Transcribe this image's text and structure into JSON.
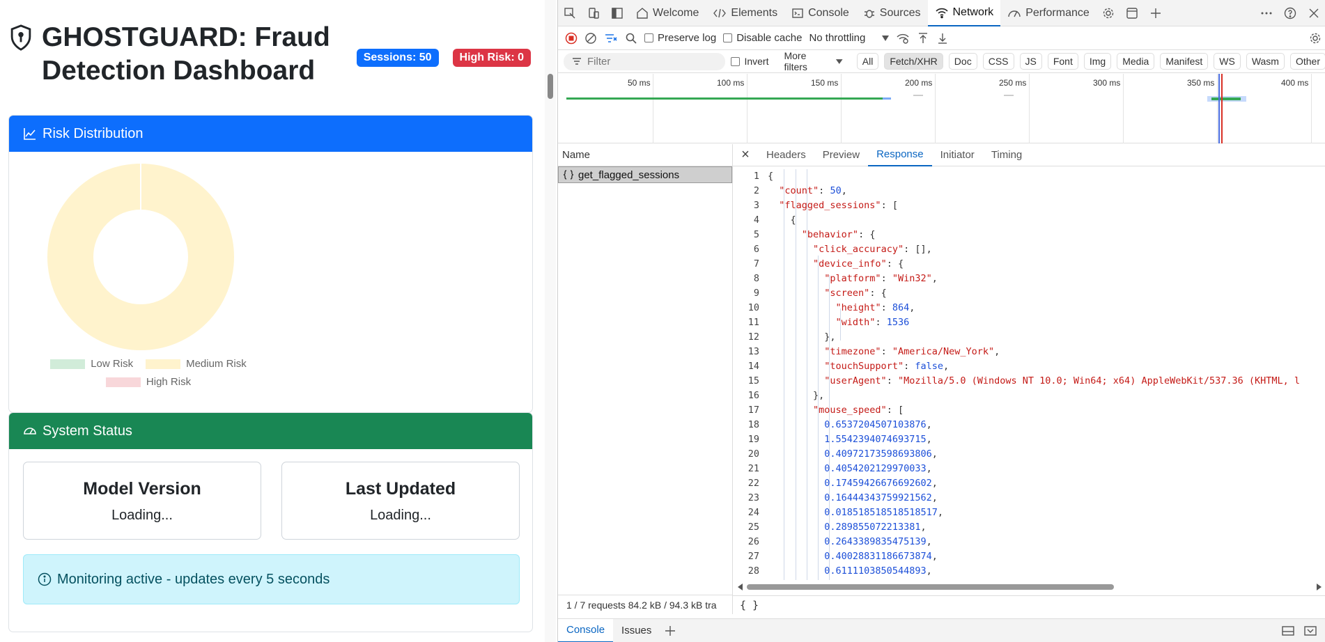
{
  "page": {
    "title": "GHOSTGUARD: Fraud Detection Dashboard",
    "badges": {
      "sessions": "Sessions: 50",
      "high_risk": "High Risk: 0"
    },
    "risk_card": {
      "title": "Risk Distribution",
      "legend": [
        "Low Risk",
        "Medium Risk",
        "High Risk"
      ],
      "colors": {
        "low": "#d1ecd9",
        "medium": "#fff3cd",
        "high": "#f8d7da"
      }
    },
    "status_card": {
      "title": "System Status",
      "model_label": "Model Version",
      "model_value": "Loading...",
      "updated_label": "Last Updated",
      "updated_value": "Loading...",
      "monitoring": "Monitoring active - updates every 5 seconds"
    }
  },
  "devtools": {
    "tabs": [
      "Welcome",
      "Elements",
      "Console",
      "Sources",
      "Network",
      "Performance"
    ],
    "active_tab": "Network",
    "toolbar": {
      "preserve_log": "Preserve log",
      "disable_cache": "Disable cache",
      "throttling": "No throttling"
    },
    "filterbar": {
      "filter_placeholder": "Filter",
      "invert": "Invert",
      "more_filters": "More filters",
      "types": [
        "All",
        "Fetch/XHR",
        "Doc",
        "CSS",
        "JS",
        "Font",
        "Img",
        "Media",
        "Manifest",
        "WS",
        "Wasm",
        "Other"
      ]
    },
    "timeline_ticks": [
      "50 ms",
      "100 ms",
      "150 ms",
      "200 ms",
      "250 ms",
      "300 ms",
      "350 ms",
      "400 ms"
    ],
    "name_header": "Name",
    "request_name": "get_flagged_sessions",
    "detail_tabs": [
      "Headers",
      "Preview",
      "Response",
      "Initiator",
      "Timing"
    ],
    "active_detail_tab": "Response",
    "response_lines": [
      "{",
      "  \"count\": 50,",
      "  \"flagged_sessions\": [",
      "    {",
      "      \"behavior\": {",
      "        \"click_accuracy\": [],",
      "        \"device_info\": {",
      "          \"platform\": \"Win32\",",
      "          \"screen\": {",
      "            \"height\": 864,",
      "            \"width\": 1536",
      "          },",
      "          \"timezone\": \"America/New_York\",",
      "          \"touchSupport\": false,",
      "          \"userAgent\": \"Mozilla/5.0 (Windows NT 10.0; Win64; x64) AppleWebKit/537.36 (KHTML, l",
      "        },",
      "        \"mouse_speed\": [",
      "          0.6537204507103876,",
      "          1.5542394074693715,",
      "          0.40972173598693806,",
      "          0.4054202129970033,",
      "          0.17459426676692602,",
      "          0.16444343759921562,",
      "          0.018518518518518517,",
      "          0.289855072213381,",
      "          0.2643389835475139,",
      "          0.40028831186673874,",
      "          0.6111103850544893,"
    ],
    "response_footer": "{ }",
    "status": "1 / 7 requests   84.2 kB / 94.3 kB tra",
    "drawer_tabs": [
      "Console",
      "Issues"
    ]
  }
}
